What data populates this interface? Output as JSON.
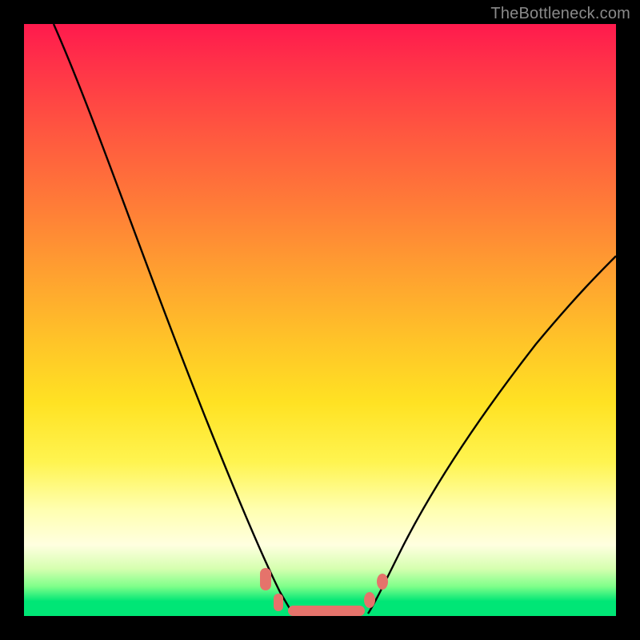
{
  "watermark": "TheBottleneck.com",
  "chart_data": {
    "type": "line",
    "title": "",
    "xlabel": "",
    "ylabel": "",
    "xlim": [
      0,
      100
    ],
    "ylim": [
      0,
      100
    ],
    "series": [
      {
        "name": "left-curve",
        "x": [
          5,
          10,
          15,
          20,
          25,
          30,
          35,
          38,
          41,
          43,
          45
        ],
        "values": [
          100,
          88,
          74,
          60,
          46,
          32,
          19,
          11,
          6,
          3,
          1
        ]
      },
      {
        "name": "right-curve",
        "x": [
          58,
          60,
          63,
          67,
          72,
          78,
          85,
          92,
          100
        ],
        "values": [
          1,
          3,
          7,
          13,
          21,
          30,
          40,
          50,
          61
        ]
      },
      {
        "name": "floor-segment",
        "x": [
          45,
          58
        ],
        "values": [
          0,
          0
        ]
      }
    ],
    "markers": [
      {
        "name": "left-dot-upper",
        "x": 41,
        "y": 6,
        "shape": "round"
      },
      {
        "name": "left-dot-lower",
        "x": 43,
        "y": 2,
        "shape": "round"
      },
      {
        "name": "right-dot-lower",
        "x": 58,
        "y": 2,
        "shape": "round"
      },
      {
        "name": "right-dot-upper",
        "x": 60,
        "y": 6,
        "shape": "round"
      },
      {
        "name": "floor-bar",
        "x": 51,
        "y": 0,
        "shape": "bar"
      }
    ],
    "colors": {
      "curve": "#000000",
      "marker": "#e5736b",
      "gradient_top": "#ff1a4d",
      "gradient_mid": "#ffe223",
      "gradient_bottom": "#00e676",
      "frame": "#000000"
    }
  }
}
